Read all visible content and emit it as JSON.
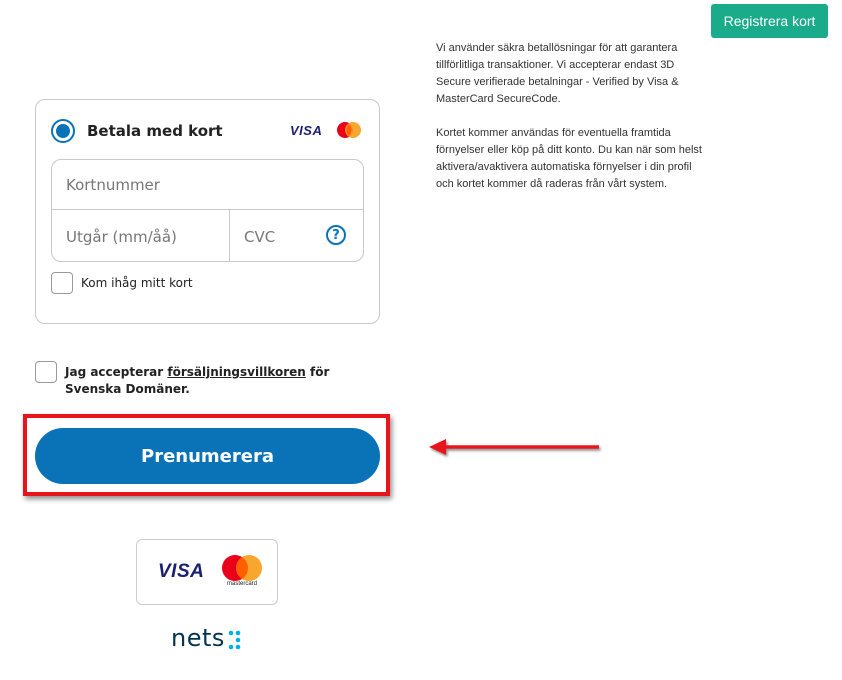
{
  "header": {
    "register_label": "Registrera kort"
  },
  "info": {
    "paragraph1": "Vi använder säkra betallösningar för att garantera tillförlitliga transaktioner. Vi accepterar endast 3D Secure verifierade betalningar - Verified by Visa & MasterCard SecureCode.",
    "paragraph2": "Kortet kommer användas för eventuella framtida förnyelser eller köp på ditt konto. Du kan när som helst aktivera/avaktivera automatiska förnyelser i din profil och kortet kommer då raderas från vårt system."
  },
  "payment": {
    "method_label": "Betala med kort",
    "visa_text": "VISA",
    "card_number_placeholder": "Kortnummer",
    "expiry_placeholder": "Utgår (mm/åå)",
    "cvc_placeholder": "CVC",
    "help_symbol": "?",
    "remember_label": "Kom ihåg mitt kort",
    "remember_checked": false,
    "selected": true
  },
  "terms": {
    "prefix": "Jag accepterar ",
    "link": "försäljningsvillkoren",
    "suffix": " för Svenska Domäner.",
    "checked": false
  },
  "subscribe": {
    "label": "Prenumerera"
  },
  "logos": {
    "visa_text": "VISA",
    "mastercard_text": "mastercard",
    "nets_text": "nets"
  },
  "colors": {
    "primary": "#0a73b8",
    "register": "#1aab8b",
    "highlight": "#e8141c",
    "visa": "#1a1f71",
    "mc_red": "#eb001b",
    "mc_orange": "#f79e1b",
    "nets_dots": "#00b0e6"
  },
  "icons": {
    "radio": "radio-selected-icon",
    "help": "help-circle-icon",
    "arrow": "red-arrow-left-icon",
    "mastercard": "mastercard-icon",
    "nets": "nets-dots-icon"
  }
}
